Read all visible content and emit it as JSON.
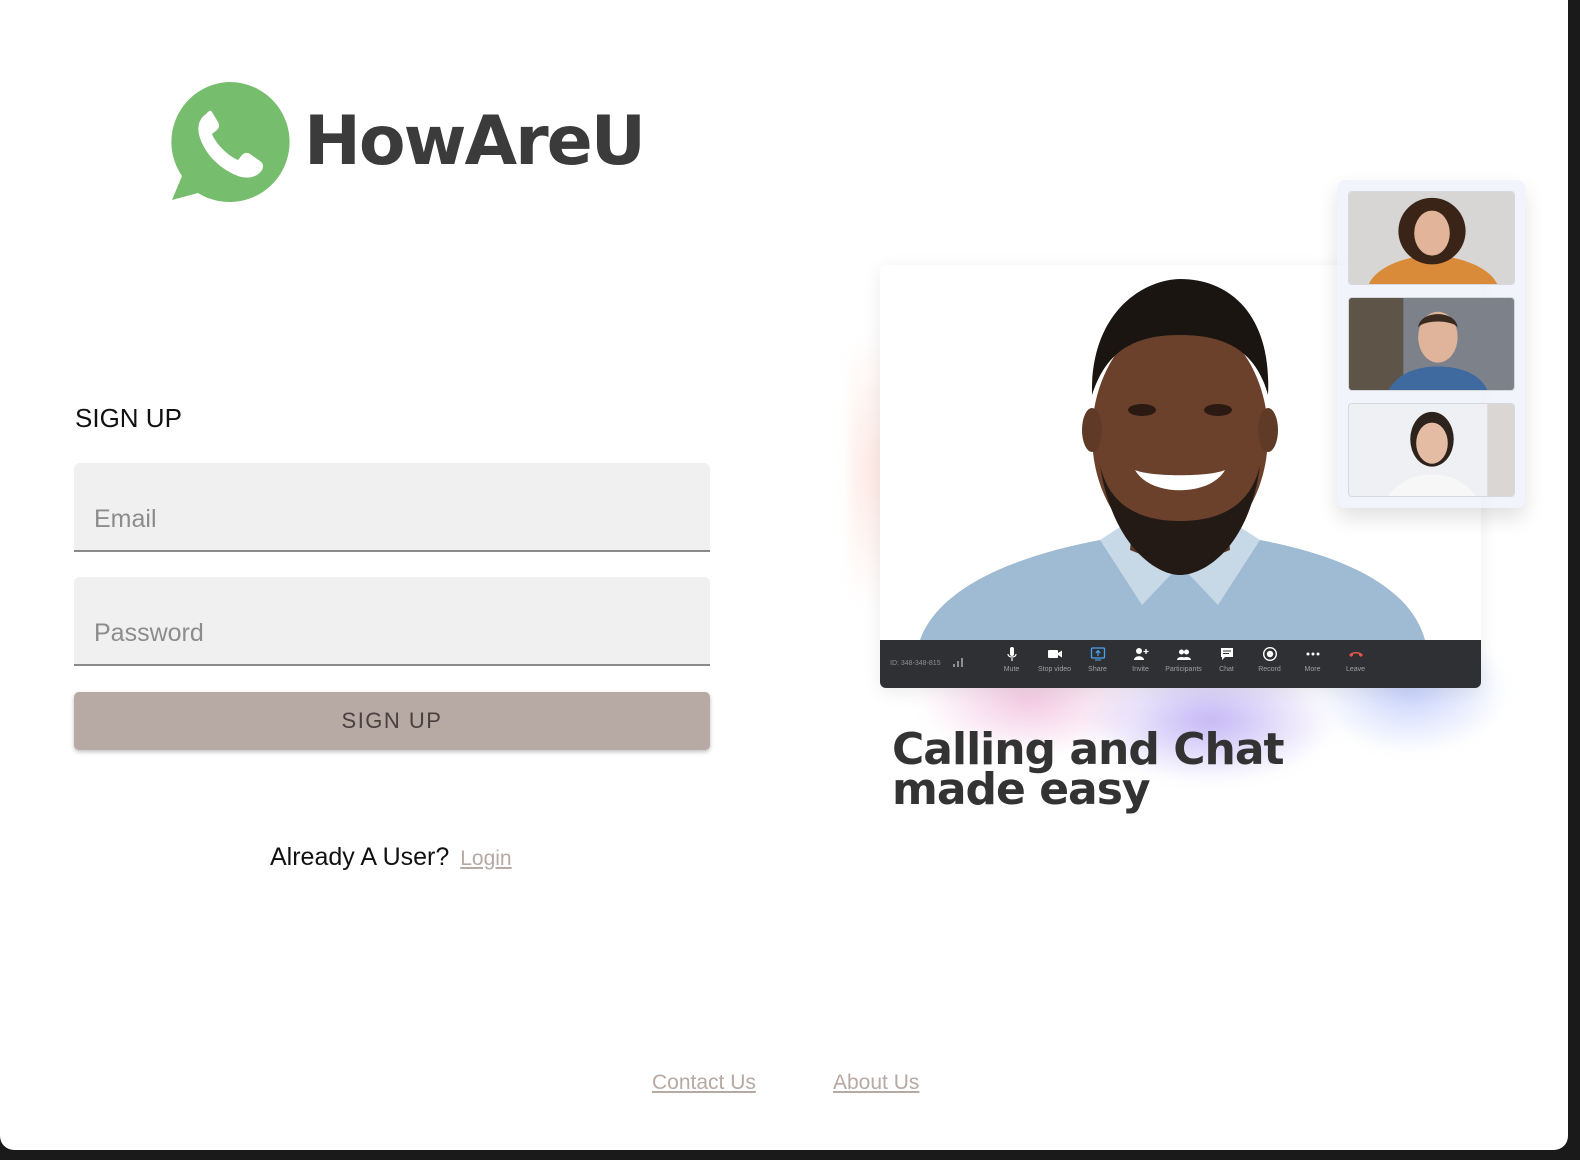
{
  "brand": {
    "name": "HowAreU",
    "logo_icon": "phone-chat-bubble-icon",
    "logo_color": "#76bd6e"
  },
  "form": {
    "title": "SIGN UP",
    "email_placeholder": "Email",
    "password_placeholder": "Password",
    "submit_label": "SIGN UP",
    "submit_color": "#b7a9a3"
  },
  "login_prompt": {
    "text": "Already A User?",
    "link_label": "Login"
  },
  "illustration": {
    "meeting_id": "ID: 348-348-815",
    "toolbar": [
      {
        "label": "Mute",
        "icon": "microphone-icon"
      },
      {
        "label": "Stop video",
        "icon": "video-camera-icon"
      },
      {
        "label": "Share",
        "icon": "share-screen-icon"
      },
      {
        "label": "Invite",
        "icon": "invite-user-icon"
      },
      {
        "label": "Participants",
        "icon": "participants-icon"
      },
      {
        "label": "Chat",
        "icon": "chat-icon"
      },
      {
        "label": "Record",
        "icon": "record-icon"
      },
      {
        "label": "More",
        "icon": "more-dots-icon"
      },
      {
        "label": "Leave",
        "icon": "leave-call-icon"
      }
    ]
  },
  "headline": {
    "line1": "Calling and Chat",
    "line2": "made easy"
  },
  "footer": {
    "contact_label": "Contact Us",
    "about_label": "About Us"
  }
}
